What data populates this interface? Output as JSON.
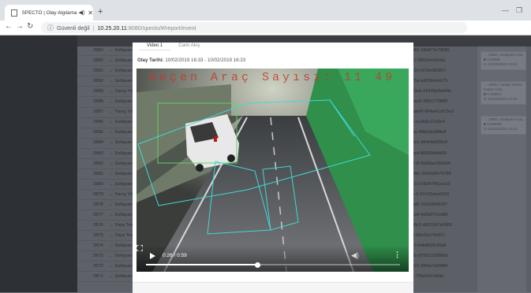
{
  "browser": {
    "tab_title": "SPECTO | Olay Algılama Sis",
    "new_tab": "+",
    "url_security": "Güvenli değil",
    "url_host": "10.25.20.11",
    "url_path": ":8080/specto/#/report/event"
  },
  "table": {
    "rows": [
      {
        "id": "2883",
        "status": "Sollayan",
        "hash": "d82-28b872e78081"
      },
      {
        "id": "2882",
        "status": "Sollayan",
        "hash": "57-8602e4d2e8a"
      },
      {
        "id": "2881",
        "status": "Sollayan",
        "hash": "c2cf-879e082807"
      },
      {
        "id": "2890",
        "status": "Sollayan",
        "hash": "75a-b4058e6e675"
      },
      {
        "id": "2889",
        "status": "Yanış Yönde",
        "hash": "e3e6-23428a9e04fe"
      },
      {
        "id": "2888",
        "status": "Sollayan",
        "hash": "eec5-39817708f8f"
      },
      {
        "id": "2887",
        "status": "Yanış Yönde",
        "hash": "ade8f-984a41c873e3"
      },
      {
        "id": "2886",
        "status": "Sollayan",
        "hash": "5-ea3b8c22a9c4"
      },
      {
        "id": "2885",
        "status": "Sollayan",
        "hash": "8a-49b0afc088e8"
      },
      {
        "id": "2884",
        "status": "Sollayan",
        "hash": "de1-484efa6f00c8"
      },
      {
        "id": "2883",
        "status": "Sollayan",
        "hash": "4e4-800994bbf63"
      },
      {
        "id": "2882",
        "status": "Sollayan",
        "hash": "0-9f-8d09ae09b5d4"
      },
      {
        "id": "2881",
        "status": "Sollayan",
        "hash": "bf9c-2041b0979786"
      },
      {
        "id": "2880",
        "status": "Sollayan",
        "hash": "15-9-0b9f7451ae15"
      },
      {
        "id": "2879",
        "status": "Yanış Yönde",
        "hash": "b-2-37e22cba6420"
      },
      {
        "id": "2878",
        "status": "Sollayan",
        "hash": "ad5-1162df041f37"
      },
      {
        "id": "2877",
        "status": "Sollayan",
        "hash": "ce8-4a0b072ed98"
      },
      {
        "id": "2876",
        "status": "Yaya Tespit",
        "hash": "d0c2-d0032b7e9900"
      },
      {
        "id": "2875",
        "status": "Yaya Tespit",
        "hash": "0-36e26e750917"
      },
      {
        "id": "2874",
        "status": "Sollayan",
        "hash": "c3-b4b862f149a8"
      },
      {
        "id": "2873",
        "status": "Sollayan",
        "hash": "3b-8755215998dd"
      },
      {
        "id": "2872",
        "status": "Sollayan",
        "hash": "021-f984a7af5884"
      },
      {
        "id": "2871",
        "status": "Sollayan",
        "hash": "1-7f0a1b2c3d4e"
      }
    ]
  },
  "right_panel": {
    "cards": [
      {
        "line1": "→ 3052 | Sollayan Araç",
        "line2": "■ CAM08",
        "line3": "⊙ 11/02/2019 13:21"
      },
      {
        "line1": "→ 3051 | Yanlış Yönde",
        "line2": "Gidən Araç",
        "line3": "■ CAM012",
        "line4": "⊙ 11/02/2019 13:22"
      },
      {
        "line1": "→ 3050 | Sollayan Araç",
        "line2": "■ CAM009",
        "line3": "⊙ 11/02/2019 13:12"
      }
    ]
  },
  "modal": {
    "tabs": [
      "Video 1",
      "Canlı Akış"
    ],
    "datetime_label": "Olay Tarihi:",
    "datetime_value": "10/02/2019 16:33 - 10/02/2019 16:33",
    "overlay_text": "Geçen Araç Sayısı: 11 49",
    "current_time": "0:26",
    "duration": "0:59",
    "progress_fraction": 0.44
  }
}
